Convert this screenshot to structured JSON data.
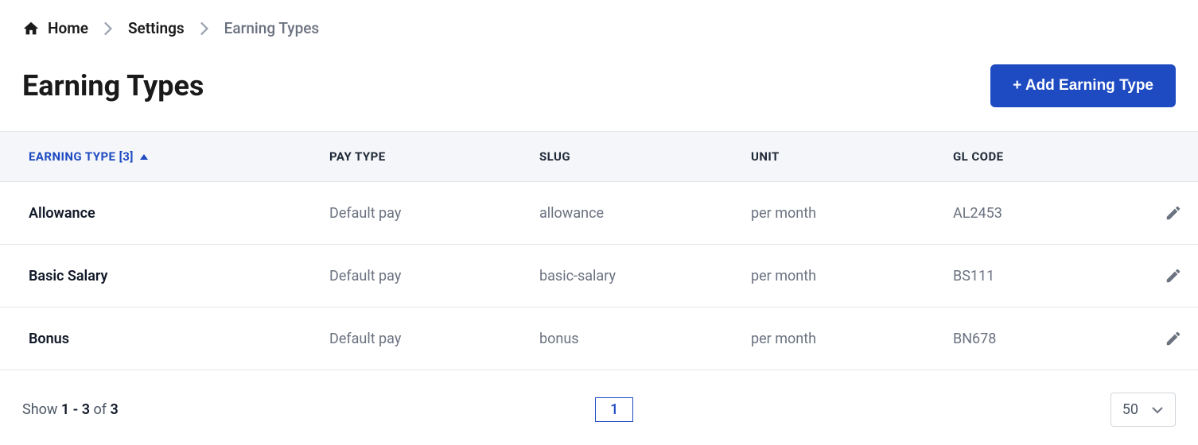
{
  "breadcrumb": {
    "home": "Home",
    "settings": "Settings",
    "current": "Earning Types"
  },
  "header": {
    "title": "Earning Types",
    "add_button": "+ Add Earning Type"
  },
  "table": {
    "columns": {
      "name": "EARNING TYPE [3]",
      "paytype": "PAY TYPE",
      "slug": "SLUG",
      "unit": "UNIT",
      "glcode": "GL CODE"
    },
    "rows": [
      {
        "name": "Allowance",
        "paytype": "Default pay",
        "slug": "allowance",
        "unit": "per month",
        "glcode": "AL2453"
      },
      {
        "name": "Basic Salary",
        "paytype": "Default pay",
        "slug": "basic-salary",
        "unit": "per month",
        "glcode": "BS111"
      },
      {
        "name": "Bonus",
        "paytype": "Default pay",
        "slug": "bonus",
        "unit": "per month",
        "glcode": "BN678"
      }
    ]
  },
  "footer": {
    "show_prefix": "Show ",
    "range": "1 - 3",
    "of": " of ",
    "total": "3",
    "page": "1",
    "page_size": "50"
  }
}
